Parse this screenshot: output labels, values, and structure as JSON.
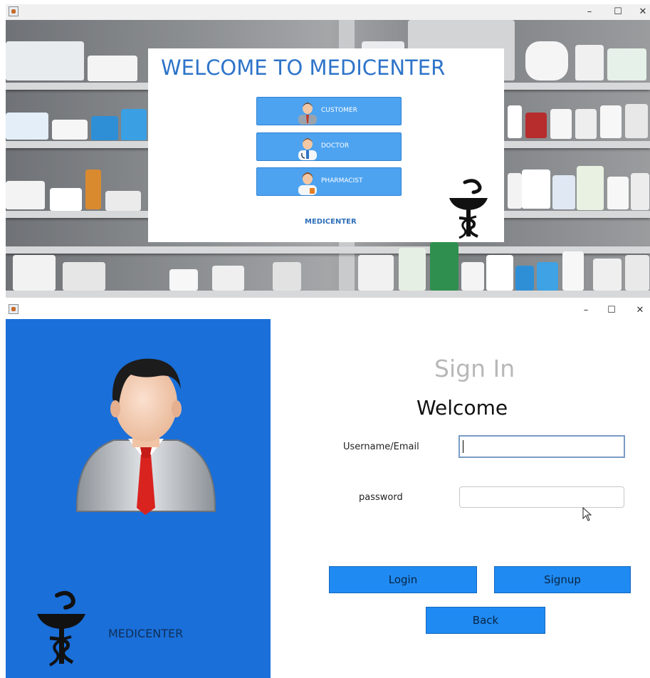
{
  "welcome_window": {
    "controls": {
      "minimize": "–",
      "maximize": "☐",
      "close": "✕"
    },
    "title": "WELCOME TO MEDICENTER",
    "roles": [
      {
        "label": "CUSTOMER"
      },
      {
        "label": "DOCTOR"
      },
      {
        "label": "PHARMACIST"
      }
    ],
    "brand": "MEDICENTER"
  },
  "signin_window": {
    "controls": {
      "minimize": "–",
      "maximize": "☐",
      "close": "✕"
    },
    "brand": "MEDICENTER",
    "title": "Sign In",
    "subtitle": "Welcome",
    "username_label": "Username/Email",
    "username_value": "",
    "password_label": "password",
    "password_value": "",
    "login_label": "Login",
    "signup_label": "Signup",
    "back_label": "Back"
  },
  "colors": {
    "title_blue": "#2e74c9",
    "role_button": "#4da3f0",
    "left_panel": "#1a6fd9",
    "action_button": "#1f8af2"
  }
}
